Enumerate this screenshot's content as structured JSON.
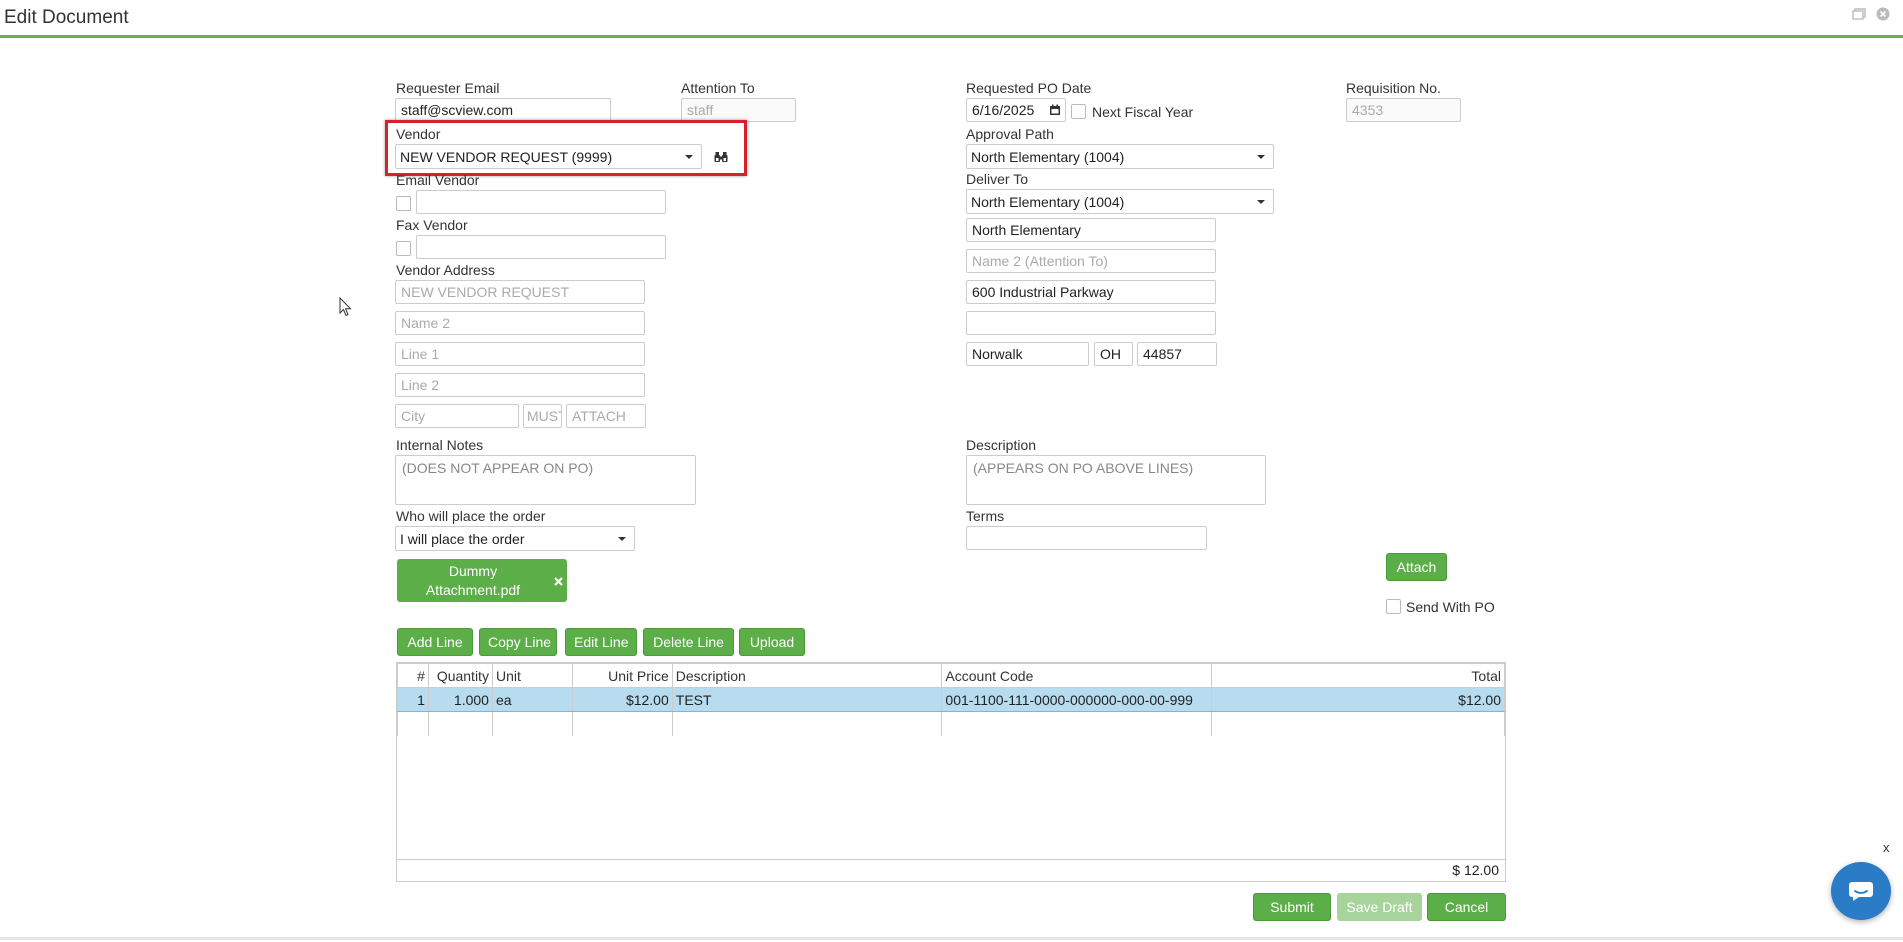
{
  "window": {
    "title": "Edit Document",
    "restore_icon": "restore-icon",
    "close_icon": "close-circle-icon"
  },
  "form": {
    "requester_email": {
      "label": "Requester Email",
      "value": "staff@scview.com"
    },
    "attention_to": {
      "label": "Attention To",
      "placeholder": "staff"
    },
    "requested_po_date": {
      "label": "Requested PO Date",
      "value": "6/16/2025"
    },
    "next_fiscal_year": {
      "label": "Next Fiscal Year",
      "checked": false
    },
    "requisition_no": {
      "label": "Requisition No.",
      "value": "4353"
    },
    "vendor": {
      "label": "Vendor",
      "value": "NEW VENDOR REQUEST (9999)"
    },
    "approval_path": {
      "label": "Approval Path",
      "value": "North Elementary (1004)"
    },
    "email_vendor": {
      "label": "Email Vendor"
    },
    "deliver_to": {
      "label": "Deliver To",
      "value": "North Elementary (1004)",
      "name": "North Elementary",
      "name2_placeholder": "Name 2 (Attention To)",
      "line1": "600 Industrial Parkway",
      "line2": "",
      "city": "Norwalk",
      "state": "OH",
      "zip": "44857"
    },
    "fax_vendor": {
      "label": "Fax Vendor"
    },
    "vendor_address": {
      "label": "Vendor Address",
      "name": "NEW VENDOR REQUEST",
      "name2_placeholder": "Name 2",
      "line1_placeholder": "Line 1",
      "line2_placeholder": "Line 2",
      "city_placeholder": "City",
      "state": "MUST",
      "zip": "ATTACH"
    },
    "internal_notes": {
      "label": "Internal Notes",
      "placeholder": "(DOES NOT APPEAR ON PO)"
    },
    "description": {
      "label": "Description",
      "placeholder": "(APPEARS ON PO ABOVE LINES)"
    },
    "who_places": {
      "label": "Who will place the order",
      "value": "I will place the order"
    },
    "terms": {
      "label": "Terms",
      "value": ""
    },
    "attachment": {
      "name": "Dummy Attachment.pdf"
    },
    "attach_button": "Attach",
    "send_with_po": {
      "label": "Send With PO",
      "checked": false
    }
  },
  "line_toolbar": {
    "add": "Add Line",
    "copy": "Copy Line",
    "edit": "Edit Line",
    "delete": "Delete Line",
    "upload": "Upload"
  },
  "lines_table": {
    "columns": [
      "#",
      "Quantity",
      "Unit",
      "Unit Price",
      "Description",
      "Account Code",
      "Total"
    ],
    "rows": [
      {
        "num": "1",
        "quantity": "1.000",
        "unit": "ea",
        "unit_price": "$12.00",
        "description": "TEST",
        "account_code": "001-1100-111-0000-000000-000-00-999",
        "total": "$12.00"
      }
    ],
    "footer_total": "$ 12.00"
  },
  "footer_buttons": {
    "submit": "Submit",
    "save_draft": "Save Draft",
    "cancel": "Cancel"
  },
  "chat": {
    "close": "x",
    "icon": "chat-bubble-icon"
  },
  "colors": {
    "accent_green": "#5cae48",
    "highlight_red": "#d6222a",
    "selected_row": "#b8dcef",
    "chat_blue": "#2b7cc7"
  }
}
